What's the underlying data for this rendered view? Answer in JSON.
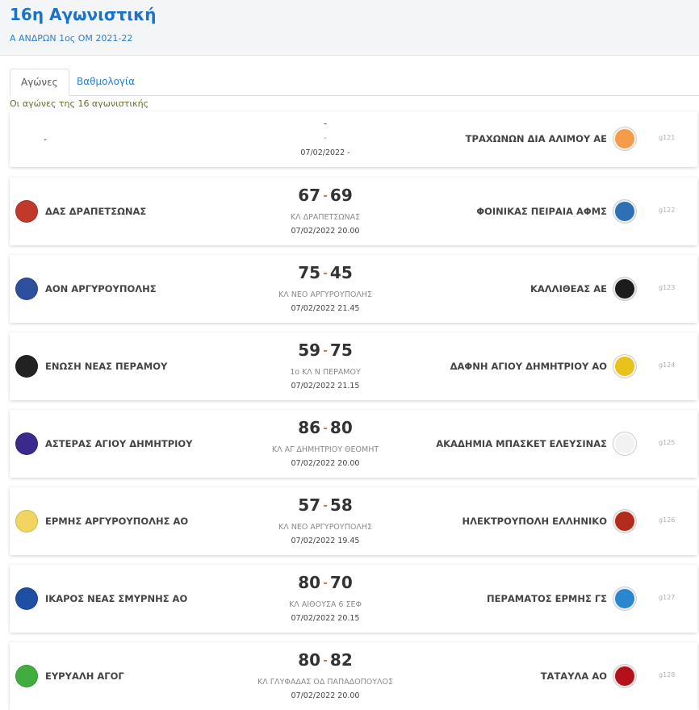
{
  "header": {
    "title": "16η Αγωνιστική",
    "subtitle": "Α ΑΝΔΡΩΝ 1ος ΟΜ 2021-22"
  },
  "tabs": [
    {
      "label": "Αγώνες",
      "active": true
    },
    {
      "label": "Βαθμολογία",
      "active": false
    }
  ],
  "caption": "Οι αγώνες της 16 αγωνιστικής",
  "matches": [
    {
      "home": "-",
      "away": "ΤΡΑΧΩΝΩΝ ΔΙΑ ΑΛΙΜΟΥ ΑΕ",
      "home_score": "-",
      "away_score": "",
      "venue": "-",
      "datetime": "07/02/2022 -",
      "id": "g121",
      "home_color": "#ffffff",
      "away_color": "#f39c4a",
      "away_icon": "trachones-logo-icon"
    },
    {
      "home": "ΔΑΣ ΔΡΑΠΕΤΣΩΝΑΣ",
      "away": "ΦΟΙΝΙΚΑΣ ΠΕΙΡΑΙΑ ΑΦΜΣ",
      "home_score": "67",
      "away_score": "69",
      "venue": "ΚΛ ΔΡΑΠΕΤΣΩΝΑΣ",
      "datetime": "07/02/2022 20.00",
      "id": "g122",
      "home_color": "#c0392b",
      "away_color": "#2f6fb5",
      "home_icon": "drapetsona-logo-icon",
      "away_icon": "foinikas-logo-icon"
    },
    {
      "home": "ΑΟΝ ΑΡΓΥΡΟΥΠΟΛΗΣ",
      "away": "ΚΑΛΛΙΘΕΑΣ ΑΕ",
      "home_score": "75",
      "away_score": "45",
      "venue": "ΚΛ ΝΕΟ ΑΡΓΥΡΟΥΠΟΛΗΣ",
      "datetime": "07/02/2022 21.45",
      "id": "g123",
      "home_color": "#2c4f9e",
      "away_color": "#1c1c1c",
      "home_icon": "aon-logo-icon",
      "away_icon": "kallithea-logo-icon"
    },
    {
      "home": "ΕΝΩΣΗ ΝΕΑΣ ΠΕΡΑΜΟΥ",
      "away": "ΔΑΦΝΗ ΑΓΙΟΥ ΔΗΜΗΤΡΙΟΥ ΑΟ",
      "home_score": "59",
      "away_score": "75",
      "venue": "1ο ΚΛ Ν ΠΕΡΑΜΟΥ",
      "datetime": "07/02/2022 21.15",
      "id": "g124",
      "home_color": "#222222",
      "away_color": "#e8c21a",
      "home_icon": "eagle-logo-icon",
      "away_icon": "dafni-logo-icon"
    },
    {
      "home": "ΑΣΤΕΡΑΣ ΑΓΙΟΥ ΔΗΜΗΤΡΙΟΥ",
      "away": "ΑΚΑΔΗΜΙΑ ΜΠΑΣΚΕΤ ΕΛΕΥΣΙΝΑΣ",
      "home_score": "86",
      "away_score": "80",
      "venue": "ΚΛ ΑΓ ΔΗΜΗΤΡΙΟΥ ΘΕΟΜΗΤ",
      "datetime": "07/02/2022 20.00",
      "id": "g125",
      "home_color": "#3b2a8c",
      "away_color": "#f2f2f2",
      "home_icon": "star-logo-icon",
      "away_icon": "elefsina-logo-icon"
    },
    {
      "home": "ΕΡΜΗΣ ΑΡΓΥΡΟΥΠΟΛΗΣ ΑΟ",
      "away": "ΗΛΕΚΤΡΟΥΠΟΛΗ ΕΛΛΗΝΙΚΟ",
      "home_score": "57",
      "away_score": "58",
      "venue": "ΚΛ ΝΕΟ ΑΡΓΥΡΟΥΠΟΛΗΣ",
      "datetime": "07/02/2022 19.45",
      "id": "g126",
      "home_color": "#f1d560",
      "away_color": "#b22c1c",
      "home_icon": "ermis-logo-icon",
      "away_icon": "ilektroupoli-logo-icon"
    },
    {
      "home": "ΙΚΑΡΟΣ ΝΕΑΣ ΣΜΥΡΝΗΣ ΑΟ",
      "away": "ΠΕΡΑΜΑΤΟΣ ΕΡΜΗΣ ΓΣ",
      "home_score": "80",
      "away_score": "70",
      "venue": "ΚΛ ΑΙΘΟΥΣΑ 6 ΣΕΦ",
      "datetime": "07/02/2022 20.15",
      "id": "g127",
      "home_color": "#1f4fa3",
      "away_color": "#2a86cf",
      "home_icon": "ikaros-logo-icon",
      "away_icon": "peramatos-logo-icon"
    },
    {
      "home": "ΕΥΡΥΑΛΗ ΑΓΟΓ",
      "away": "ΤΑΤΑΥΛΑ ΑΟ",
      "home_score": "80",
      "away_score": "82",
      "venue": "ΚΛ ΓΛΥΦΑΔΑΣ ΟΔ ΠΑΠΑΔΟΠΟΥΛΟΣ",
      "datetime": "07/02/2022 20.00",
      "id": "g128",
      "home_color": "#3fae3f",
      "away_color": "#b3121b",
      "home_icon": "evryali-logo-icon",
      "away_icon": "tatavla-logo-icon"
    }
  ]
}
